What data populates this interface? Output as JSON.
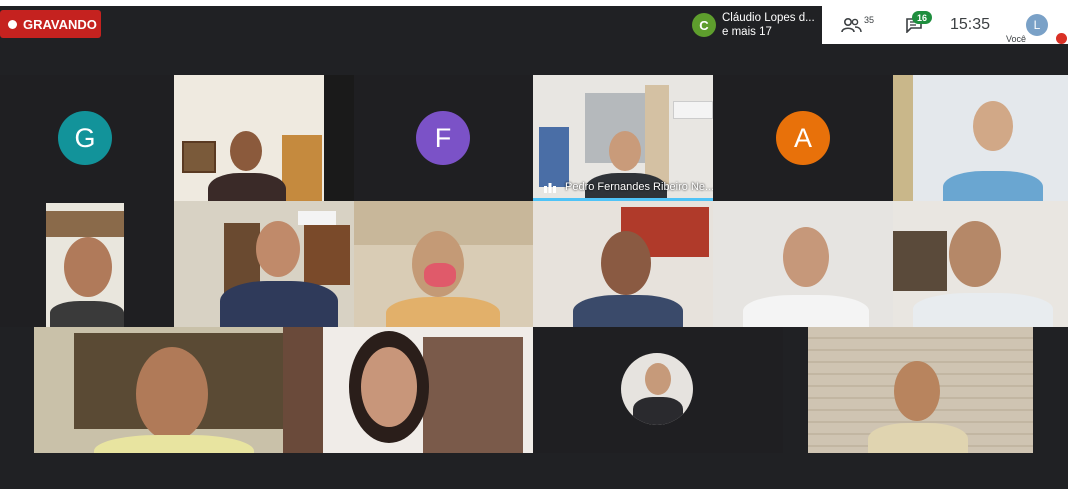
{
  "recording": {
    "label": "GRAVANDO"
  },
  "presenter": {
    "initial": "C",
    "name": "Cláudio Lopes d...",
    "more": "e mais 17"
  },
  "toolbar": {
    "participants_count": "35",
    "chat_count": "16",
    "clock": "15:35",
    "me_initial": "L",
    "me_label": "Você"
  },
  "colors": {
    "record": "#c5221f",
    "letter_g": "#12939a",
    "letter_f": "#7b52c7",
    "letter_a": "#e8710a",
    "active_speaker": "#4fc3f7"
  },
  "tiles": {
    "g": {
      "initial": "G"
    },
    "f": {
      "initial": "F"
    },
    "a": {
      "initial": "A"
    },
    "pedro": {
      "name": "Pedro Fernandes Ribeiro Ne..."
    }
  }
}
